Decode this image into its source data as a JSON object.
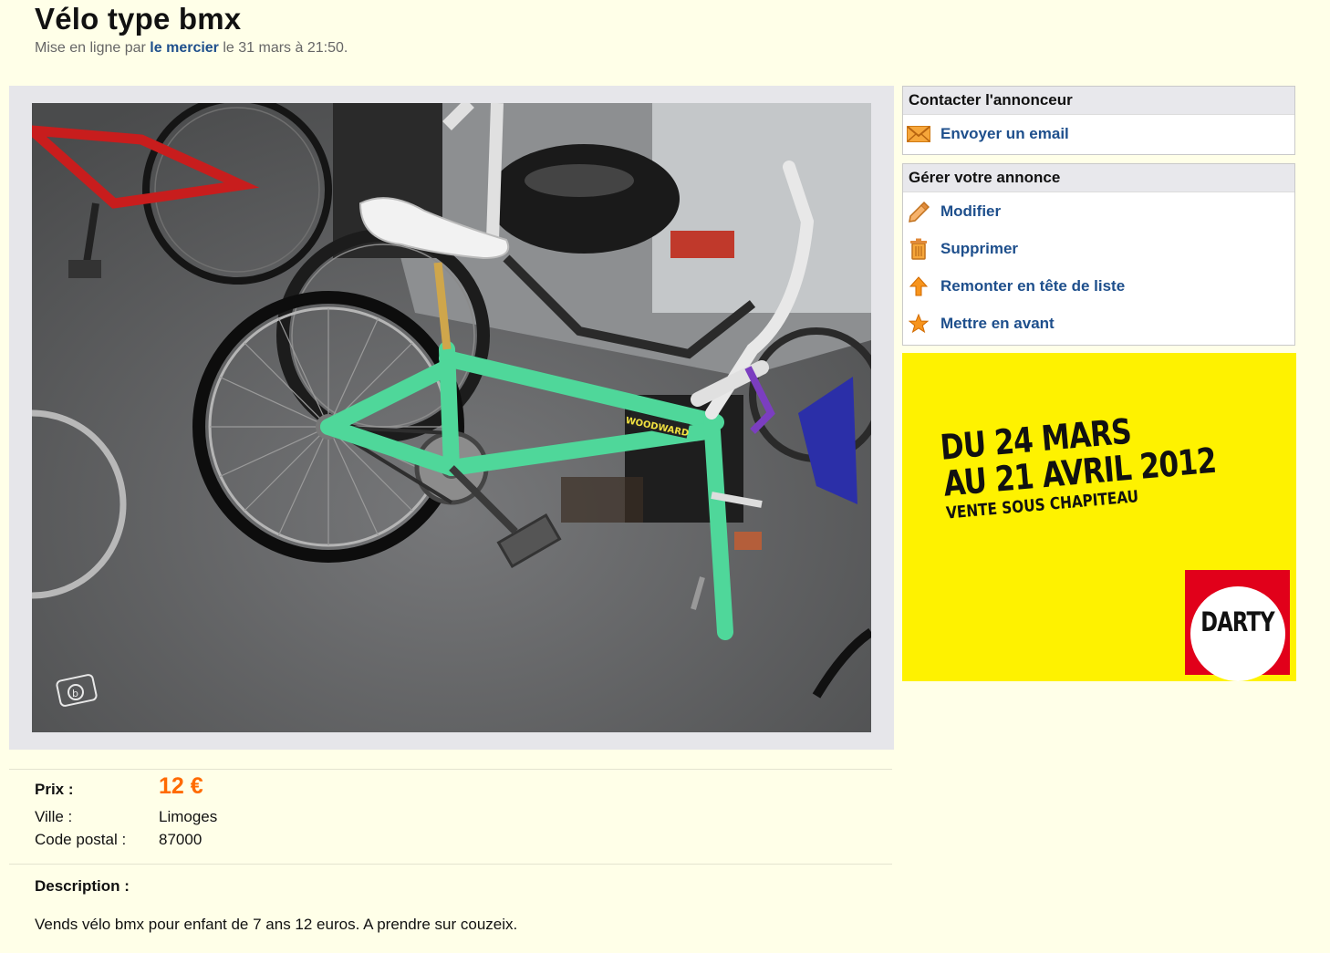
{
  "listing": {
    "title": "Vélo type bmx",
    "posted_prefix": "Mise en ligne par ",
    "author": "le mercier",
    "posted_suffix": " le 31 mars à 21:50."
  },
  "photo": {
    "frame_brand_text": "WOODWARD"
  },
  "contact_box": {
    "header": "Contacter l'annonceur",
    "items": [
      {
        "label": "Envoyer un email",
        "icon": "envelope-icon"
      }
    ]
  },
  "manage_box": {
    "header": "Gérer votre annonce",
    "items": [
      {
        "label": "Modifier",
        "icon": "pencil-icon"
      },
      {
        "label": "Supprimer",
        "icon": "trash-icon"
      },
      {
        "label": "Remonter en tête de liste",
        "icon": "arrow-up-icon"
      },
      {
        "label": "Mettre en avant",
        "icon": "star-icon"
      }
    ]
  },
  "ad": {
    "line1": "DU 24 MARS",
    "line2": "AU 21 AVRIL 2012",
    "line3": "VENTE SOUS CHAPITEAU",
    "brand": "DARTY",
    "background": "#fef200",
    "brand_color": "#e1001a"
  },
  "details": {
    "price_label": "Prix :",
    "price_value": "12 €",
    "city_label": "Ville :",
    "city_value": "Limoges",
    "postal_label": "Code postal :",
    "postal_value": "87000"
  },
  "description": {
    "label": "Description :",
    "text": "Vends vélo bmx pour enfant de 7 ans 12 euros. A prendre sur couzeix."
  },
  "colors": {
    "link": "#1e4f8c",
    "price": "#ff6a00",
    "page_bg": "#ffffe8"
  }
}
